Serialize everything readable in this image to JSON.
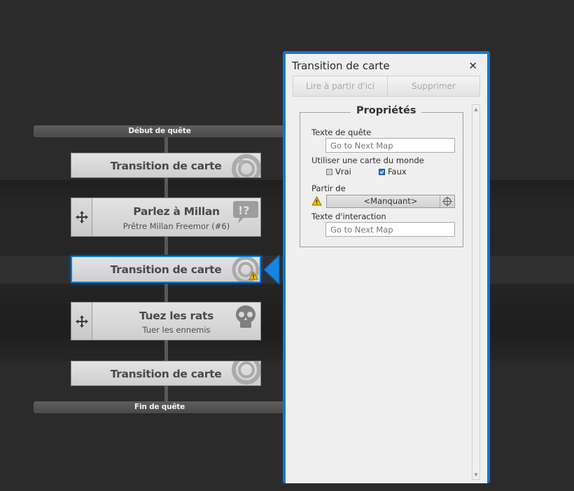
{
  "quest": {
    "start_label": "Début de quête",
    "end_label": "Fin de quête"
  },
  "nodes": [
    {
      "title": "Transition de carte",
      "icon": "map-transition-icon"
    },
    {
      "title": "Parlez à Millan",
      "subtitle": "Prêtre Millan Freemor (#6)",
      "icon": "dialog-icon"
    },
    {
      "title": "Transition de carte",
      "icon": "map-transition-icon",
      "selected": true,
      "warning": true
    },
    {
      "title": "Tuez les rats",
      "subtitle": "Tuer les ennemis",
      "icon": "skull-icon"
    },
    {
      "title": "Transition de carte",
      "icon": "map-transition-icon"
    }
  ],
  "panel": {
    "title": "Transition de carte",
    "close_glyph": "✕",
    "play_from_here": "Lire à partir d'ici",
    "delete": "Supprimer",
    "section_title": "Propriétés",
    "quest_text_label": "Texte de quête",
    "quest_text_placeholder": "Go to Next Map",
    "world_map_label": "Utiliser une carte du monde",
    "option_true": "Vrai",
    "option_false": "Faux",
    "world_map_value": "Faux",
    "start_from_label": "Partir de",
    "start_from_value": "<Manquant>",
    "interaction_text_label": "Texte d'interaction",
    "interaction_text_placeholder": "Go to Next Map"
  },
  "colors": {
    "accent": "#0e77d4",
    "background": "#2b2b2b",
    "warning": "#f2c200"
  }
}
